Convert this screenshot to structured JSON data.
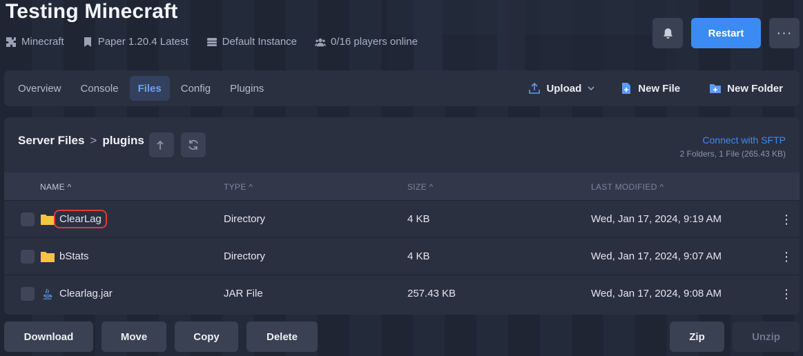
{
  "header": {
    "title": "Testing Minecraft",
    "meta": {
      "game": "Minecraft",
      "version": "Paper 1.20.4 Latest",
      "instance": "Default Instance",
      "players": "0/16 players online"
    },
    "restart_label": "Restart",
    "more_label": "···"
  },
  "nav": {
    "tabs": [
      "Overview",
      "Console",
      "Files",
      "Config",
      "Plugins"
    ],
    "active_tab": "Files",
    "upload_label": "Upload",
    "new_file_label": "New File",
    "new_folder_label": "New Folder"
  },
  "files": {
    "breadcrumb_root": "Server Files",
    "breadcrumb_separator": ">",
    "breadcrumb_current": "plugins",
    "sftp_label": "Connect with SFTP",
    "summary": "2 Folders, 1 File (265.43 KB)",
    "columns": {
      "name": "NAME",
      "type": "TYPE",
      "size": "SIZE",
      "modified": "LAST MODIFIED"
    },
    "rows": [
      {
        "name": "ClearLag",
        "type": "Directory",
        "size": "4 KB",
        "modified": "Wed, Jan 17, 2024, 9:19 AM",
        "icon": "folder-icon"
      },
      {
        "name": "bStats",
        "type": "Directory",
        "size": "4 KB",
        "modified": "Wed, Jan 17, 2024, 9:07 AM",
        "icon": "folder-icon"
      },
      {
        "name": "Clearlag.jar",
        "type": "JAR File",
        "size": "257.43 KB",
        "modified": "Wed, Jan 17, 2024, 9:08 AM",
        "icon": "java-icon"
      }
    ]
  },
  "actions": {
    "download": "Download",
    "move": "Move",
    "copy": "Copy",
    "delete": "Delete",
    "zip": "Zip",
    "unzip": "Unzip"
  },
  "colors": {
    "accent": "#3b8cf2",
    "highlight_box": "#e03a3a",
    "folder": "#f5c542"
  }
}
